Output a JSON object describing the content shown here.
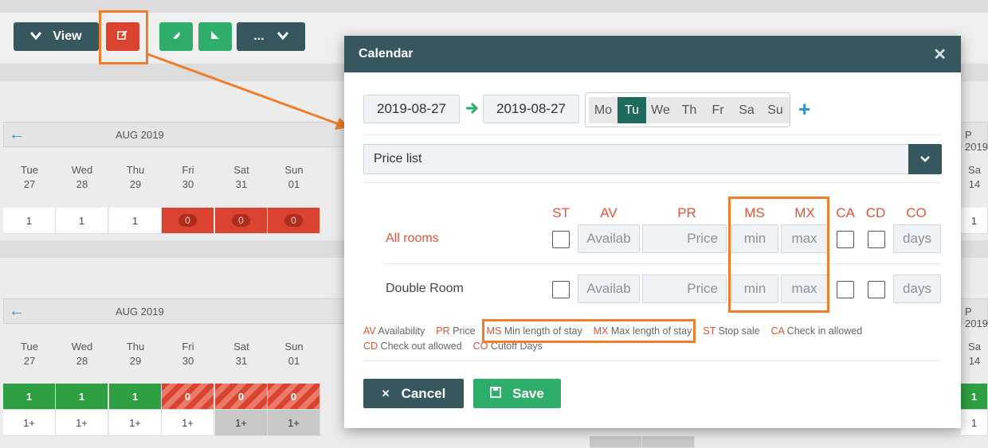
{
  "toolbar": {
    "view_label": "View",
    "more_label": "..."
  },
  "colors": {
    "modal_header": "#37575e",
    "accent_orange": "#f07d2c",
    "label_red": "#e0533a",
    "save_green": "#2eae6a",
    "cancel_dark": "#37575e",
    "weekday_active": "#1f6b5e"
  },
  "background_calendar": {
    "month": "AUG 2019",
    "edge_month": "P 2019",
    "days": [
      {
        "name": "Tue",
        "num": "27"
      },
      {
        "name": "Wed",
        "num": "28"
      },
      {
        "name": "Thu",
        "num": "29"
      },
      {
        "name": "Fri",
        "num": "30"
      },
      {
        "name": "Sat",
        "num": "31"
      },
      {
        "name": "Sun",
        "num": "01"
      }
    ],
    "edge_day": {
      "name": "Sa",
      "num": "14"
    },
    "row1_values": [
      "1",
      "1",
      "1",
      "0",
      "0",
      "0"
    ],
    "row1_edge": "1",
    "row2_values": [
      "1",
      "1",
      "1",
      "0",
      "0",
      "0"
    ],
    "row2_edge": "1",
    "row3_values": [
      "1+",
      "1+",
      "1+",
      "1+",
      "1+",
      "1+"
    ],
    "row3_edge": "1"
  },
  "modal": {
    "title": "Calendar",
    "date_from": "2019-08-27",
    "date_to": "2019-08-27",
    "weekdays": [
      "Mo",
      "Tu",
      "We",
      "Th",
      "Fr",
      "Sa",
      "Su"
    ],
    "weekday_selected": "Tu",
    "add_symbol": "+",
    "price_list_label": "Price list",
    "columns": [
      "ST",
      "AV",
      "PR",
      "MS",
      "MX",
      "CA",
      "CD",
      "CO"
    ],
    "rooms": [
      {
        "name": "All rooms",
        "avail_placeholder": "Availab",
        "price_placeholder": "Price",
        "min_placeholder": "min",
        "max_placeholder": "max",
        "days_placeholder": "days"
      },
      {
        "name": "Double Room",
        "avail_placeholder": "Availab",
        "price_placeholder": "Price",
        "min_placeholder": "min",
        "max_placeholder": "max",
        "days_placeholder": "days"
      }
    ],
    "legend": [
      {
        "key": "AV",
        "text": "Availability"
      },
      {
        "key": "PR",
        "text": "Price"
      },
      {
        "key": "MS",
        "text": "Min length of stay"
      },
      {
        "key": "MX",
        "text": "Max length of stay"
      },
      {
        "key": "ST",
        "text": "Stop sale"
      },
      {
        "key": "CA",
        "text": "Check in allowed"
      },
      {
        "key": "CD",
        "text": "Check out allowed"
      },
      {
        "key": "CO",
        "text": "Cutoff Days"
      }
    ],
    "cancel_label": "Cancel",
    "save_label": "Save"
  }
}
